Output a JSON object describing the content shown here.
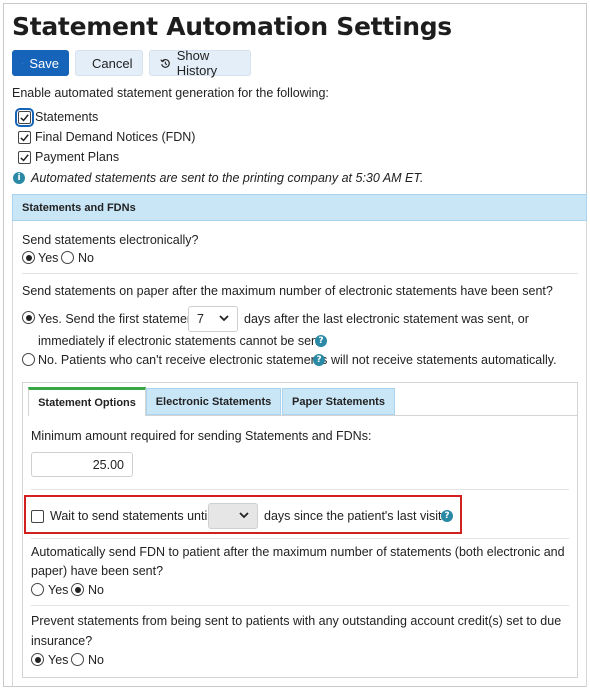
{
  "page": {
    "title": "Statement Automation Settings"
  },
  "toolbar": {
    "save_label": "Save",
    "cancel_label": "Cancel",
    "history_label": "Show History"
  },
  "automation": {
    "intro": "Enable automated statement generation for the following:",
    "options": [
      {
        "label": "Statements",
        "checked": true
      },
      {
        "label": "Final Demand Notices (FDN)",
        "checked": true
      },
      {
        "label": "Payment Plans",
        "checked": true
      }
    ],
    "note": "Automated statements are sent to the printing company at 5:30 AM ET."
  },
  "section": {
    "title": "Statements and FDNs",
    "electronic_question": "Send statements electronically?",
    "electronic_yes": "Yes",
    "electronic_no": "No",
    "electronic_selected": "Yes",
    "paper_question": "Send statements on paper after the maximum number of electronic statements have been sent?",
    "paper_yes_prefix": "Yes. Send the first statement",
    "paper_yes_days_value": "7",
    "paper_yes_suffix": "days after the last electronic statement was sent, or",
    "paper_yes_line2": "immediately if electronic statements cannot be sent.",
    "paper_no_prefix": "No. Patients who can't receive electronic statements",
    "paper_no_suffix": "will not receive statements automatically.",
    "paper_selected": "Yes"
  },
  "tabs": [
    {
      "label": "Statement Options",
      "active": true
    },
    {
      "label": "Electronic Statements",
      "active": false
    },
    {
      "label": "Paper Statements",
      "active": false
    }
  ],
  "statement_options": {
    "min_amount_label": "Minimum amount required for sending Statements and FDNs:",
    "min_amount_value": "25.00",
    "wait_checked": false,
    "wait_prefix": "Wait to send statements until",
    "wait_days_value": "",
    "wait_suffix": "days since the patient's last visit.",
    "fdn_question_line1": "Automatically send FDN to patient after the maximum number of statements (both electronic and",
    "fdn_question_line2": "paper) have been sent?",
    "fdn_yes": "Yes",
    "fdn_no": "No",
    "fdn_selected": "No",
    "credit_question_line1": "Prevent statements from being sent to patients with any outstanding account credit(s) set to due",
    "credit_question_line2": "insurance?",
    "credit_yes": "Yes",
    "credit_no": "No",
    "credit_selected": "Yes"
  },
  "colors": {
    "primary": "#1664b9",
    "section_header": "#c9e6f7",
    "active_tab_accent": "#39a844",
    "highlight_border": "#d21f1f",
    "info_icon": "#2a8aa6"
  }
}
